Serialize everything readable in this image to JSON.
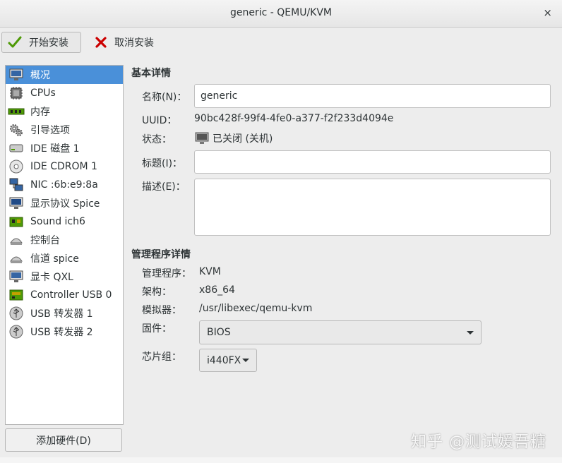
{
  "window": {
    "title": "generic - QEMU/KVM",
    "close": "×"
  },
  "toolbar": {
    "install_label": "开始安装",
    "cancel_label": "取消安装"
  },
  "sidebar": {
    "items": [
      {
        "label": "概况",
        "icon": "monitor-icon"
      },
      {
        "label": "CPUs",
        "icon": "cpu-icon"
      },
      {
        "label": "内存",
        "icon": "memory-icon"
      },
      {
        "label": "引导选项",
        "icon": "gears-icon"
      },
      {
        "label": "IDE 磁盘 1",
        "icon": "disk-icon"
      },
      {
        "label": "IDE CDROM 1",
        "icon": "cdrom-icon"
      },
      {
        "label": "NIC :6b:e9:8a",
        "icon": "network-icon"
      },
      {
        "label": "显示协议 Spice",
        "icon": "display-icon"
      },
      {
        "label": "Sound ich6",
        "icon": "sound-card-icon"
      },
      {
        "label": "控制台",
        "icon": "serial-icon"
      },
      {
        "label": "信道 spice",
        "icon": "channel-icon"
      },
      {
        "label": "显卡 QXL",
        "icon": "video-icon"
      },
      {
        "label": "Controller USB 0",
        "icon": "controller-icon"
      },
      {
        "label": "USB 转发器 1",
        "icon": "usb-icon"
      },
      {
        "label": "USB 转发器 2",
        "icon": "usb-icon"
      }
    ],
    "selected_index": 0,
    "add_hardware_label": "添加硬件(D)"
  },
  "basic": {
    "section_title": "基本详情",
    "name_label": "名称(N)：",
    "name_value": "generic",
    "uuid_label": "UUID：",
    "uuid_value": "90bc428f-99f4-4fe0-a377-f2f233d4094e",
    "status_label": "状态：",
    "status_value": "已关闭 (关机)",
    "title_label": "标题(I)：",
    "title_value": "",
    "desc_label": "描述(E)：",
    "desc_value": ""
  },
  "hypervisor": {
    "section_title": "管理程序详情",
    "hv_label": "管理程序：",
    "hv_value": "KVM",
    "arch_label": "架构：",
    "arch_value": "x86_64",
    "emu_label": "模拟器：",
    "emu_value": "/usr/libexec/qemu-kvm",
    "fw_label": "固件：",
    "fw_value": "BIOS",
    "chipset_label": "芯片组：",
    "chipset_value": "i440FX"
  },
  "watermark": "知乎 @测试媛吾糖"
}
